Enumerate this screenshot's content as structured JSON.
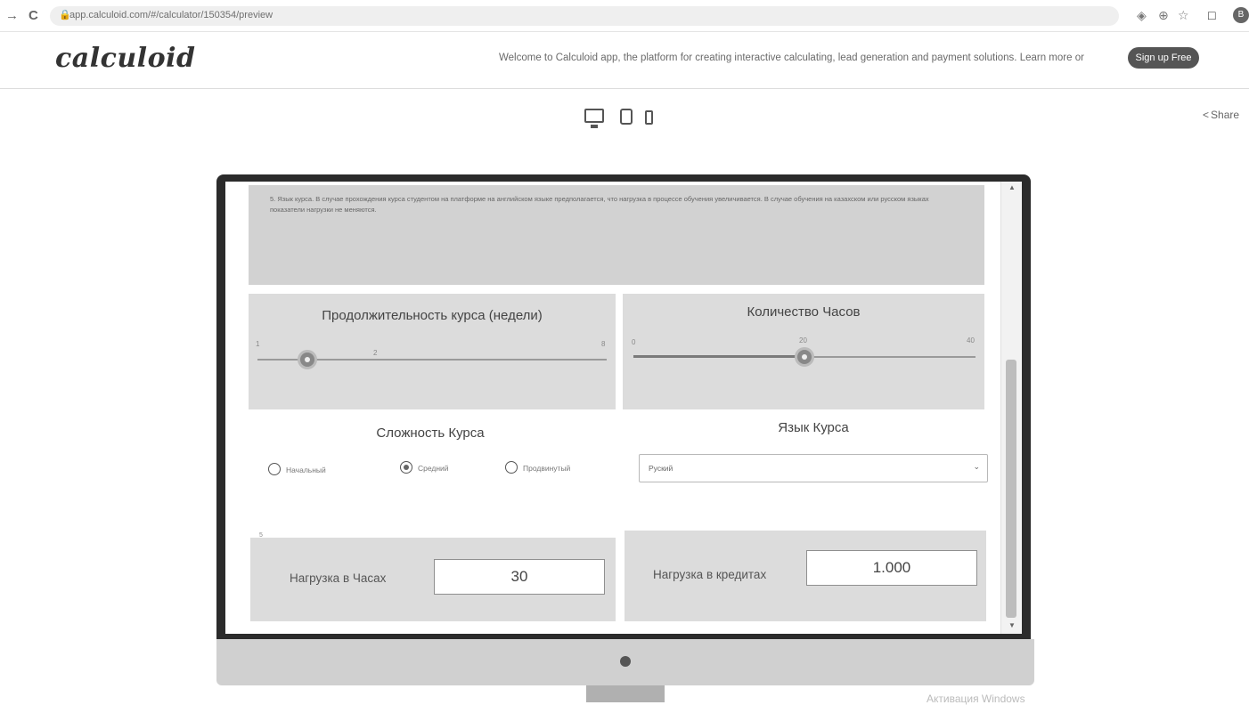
{
  "browser": {
    "back_glyph": "→",
    "reload_glyph": "C",
    "url": "app.calculoid.com/#/calculator/150354/preview",
    "extension_glyphs": [
      "◈",
      "⊕",
      "☆"
    ],
    "window_glyph": "□",
    "profile_initial": "B"
  },
  "header": {
    "logo": "calculoid",
    "welcome_text": "Welcome to Calculoid app, the platform for creating interactive calculating, lead generation and payment solutions. Learn more or",
    "signup_label": "Sign up Free"
  },
  "toolbar": {
    "device_icons": [
      "desktop-icon",
      "tablet-icon",
      "phone-icon"
    ],
    "share_label": "Share"
  },
  "calculator": {
    "note_text": "5. Язык курса. В случае прохождения курса студентом на платформе на английском языке предполагается, что нагрузка в процессе обучения увеличивается. В случае обучения на казахском или русском языках показатели нагрузки не меняются.",
    "duration": {
      "title": "Продолжительность курса (недели)",
      "min": "1",
      "value": "2",
      "max": "8",
      "fraction": 0.143
    },
    "hours": {
      "title": "Количество Часов",
      "min": "0",
      "value": "20",
      "max": "40",
      "fraction": 0.5
    },
    "difficulty": {
      "title": "Сложность Курса",
      "options": [
        "Начальный",
        "Средний",
        "Продвинутый"
      ],
      "selected": "Средний"
    },
    "language": {
      "title": "Язык Курса",
      "selected": "Руский"
    },
    "small_mark": "5",
    "result_hours": {
      "label": "Нагрузка в Часах",
      "value": "30"
    },
    "result_credits": {
      "label": "Нагрузка в кредитах",
      "value": "1.000"
    }
  },
  "os": {
    "watermark": "Активация Windows"
  }
}
